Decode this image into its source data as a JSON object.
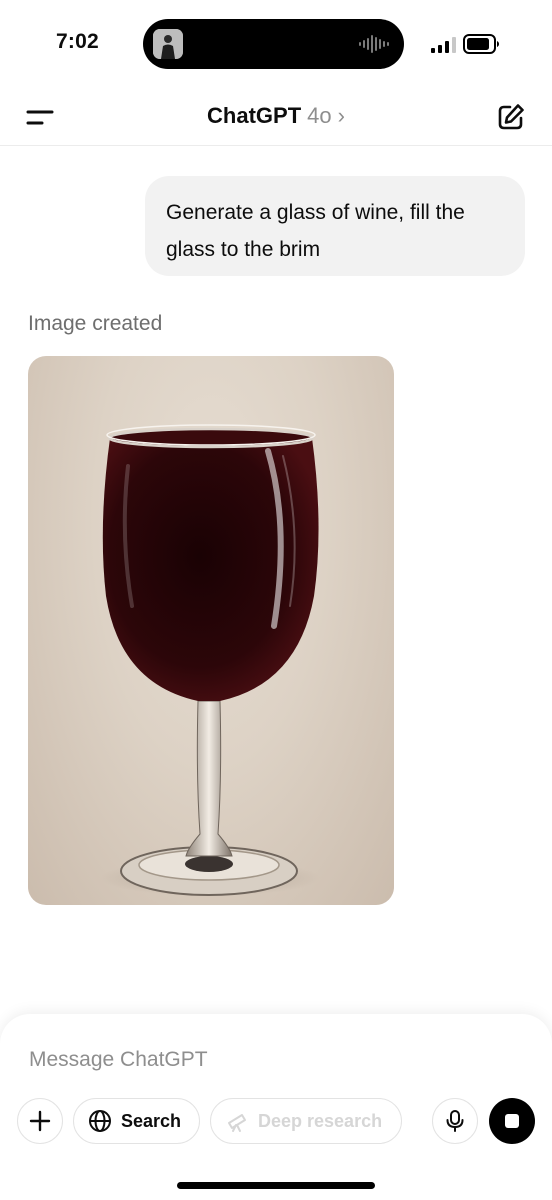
{
  "status_bar": {
    "time": "7:02"
  },
  "header": {
    "title": "ChatGPT",
    "model": "4o",
    "chevron": "›"
  },
  "conversation": {
    "user_message": "Generate a glass of wine, fill the glass to the brim",
    "assistant_status": "Image created",
    "generated_image_subject": "wine glass filled to the brim with red wine"
  },
  "composer": {
    "placeholder": "Message ChatGPT",
    "search_label": "Search",
    "deep_research_label": "Deep research"
  },
  "icons": {
    "menu": "menu-icon",
    "compose": "compose-icon",
    "plus": "plus-icon",
    "globe": "globe-icon",
    "telescope": "telescope-icon",
    "mic": "microphone-icon",
    "stop": "stop-icon"
  },
  "colors": {
    "bubble_bg": "#f2f2f2",
    "muted_text": "#8e8e8e",
    "disabled_text": "#d6d6d6",
    "wine": "#2a0608"
  }
}
